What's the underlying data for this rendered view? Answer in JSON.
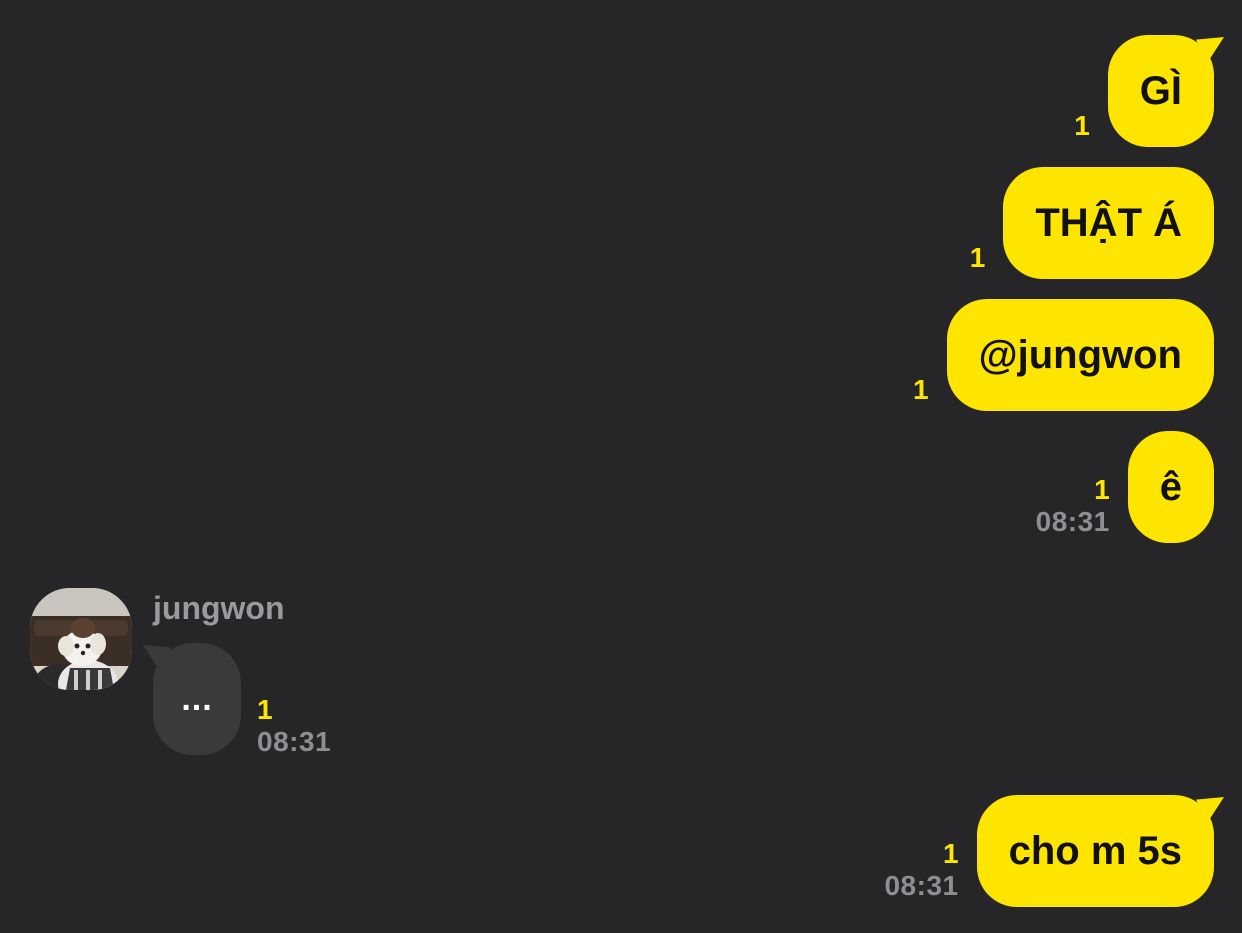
{
  "outgoing": [
    {
      "text": "GÌ",
      "unread": "1",
      "time": ""
    },
    {
      "text": "THẬT Á",
      "unread": "1",
      "time": ""
    },
    {
      "text": "@jungwon",
      "unread": "1",
      "time": ""
    },
    {
      "text": "ê",
      "unread": "1",
      "time": "08:31"
    },
    {
      "text": "cho m 5s",
      "unread": "1",
      "time": "08:31"
    }
  ],
  "incoming": {
    "sender": "jungwon",
    "text": "...",
    "unread": "1",
    "time": "08:31"
  },
  "colors": {
    "background": "#262628",
    "outgoing_bubble": "#fee500",
    "incoming_bubble": "#3a3a3c",
    "unread_count": "#ffe600",
    "timestamp": "#8e8e93"
  },
  "icons": {
    "avatar": "profile-photo-dog"
  }
}
